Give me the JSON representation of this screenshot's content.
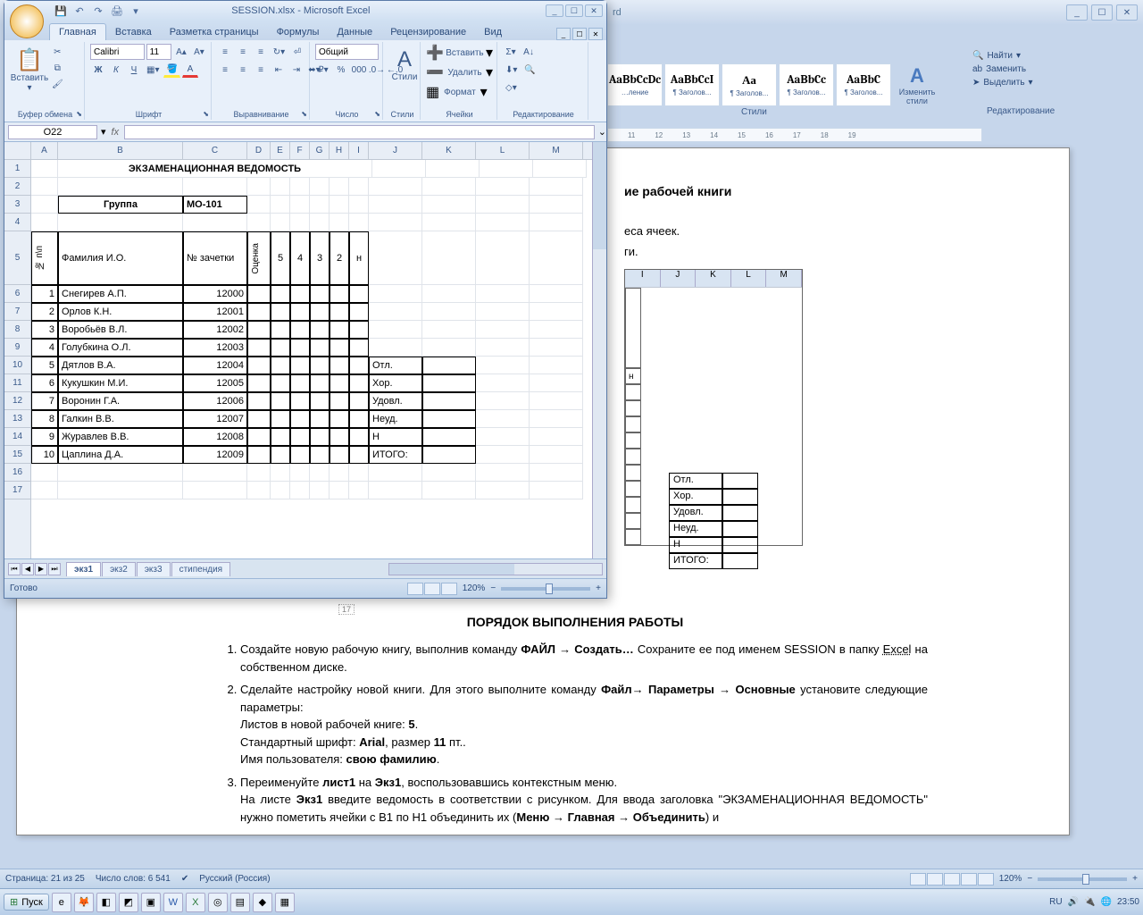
{
  "excel": {
    "title": "SESSION.xlsx - Microsoft Excel",
    "tabs": [
      "Главная",
      "Вставка",
      "Разметка страницы",
      "Формулы",
      "Данные",
      "Рецензирование",
      "Вид"
    ],
    "active_tab": 0,
    "groups": {
      "clipboard": "Буфер обмена",
      "font": "Шрифт",
      "alignment": "Выравнивание",
      "number": "Число",
      "styles": "Стили",
      "cells": "Ячейки",
      "editing": "Редактирование"
    },
    "paste": "Вставить",
    "font_name": "Calibri",
    "font_size": "11",
    "number_format": "Общий",
    "cells_insert": "Вставить",
    "cells_delete": "Удалить",
    "cells_format": "Формат",
    "styles_btn": "Стили",
    "name_box": "O22",
    "fx": "fx",
    "sheet_tabs": [
      "экз1",
      "экз2",
      "экз3",
      "стипендия"
    ],
    "active_sheet": 0,
    "status": "Готово",
    "zoom": "120%",
    "columns": [
      "A",
      "B",
      "C",
      "D",
      "E",
      "F",
      "G",
      "H",
      "I",
      "J",
      "K",
      "L",
      "M"
    ],
    "title_cell": "ЭКЗАМЕНАЦИОННАЯ ВЕДОМОСТЬ",
    "group_label": "Группа",
    "group_value": "МО-101",
    "headers": {
      "num": "№ п\\п",
      "fio": "Фамилия И.О.",
      "zach": "№ зачетки",
      "grade": "Оценка",
      "g5": "5",
      "g4": "4",
      "g3": "3",
      "g2": "2",
      "gn": "н"
    },
    "rows": [
      {
        "n": "1",
        "fio": "Снегирев А.П.",
        "z": "12000"
      },
      {
        "n": "2",
        "fio": "Орлов К.Н.",
        "z": "12001"
      },
      {
        "n": "3",
        "fio": "Воробьёв В.Л.",
        "z": "12002"
      },
      {
        "n": "4",
        "fio": "Голубкина О.Л.",
        "z": "12003"
      },
      {
        "n": "5",
        "fio": "Дятлов В.А.",
        "z": "12004"
      },
      {
        "n": "6",
        "fio": "Кукушкин М.И.",
        "z": "12005"
      },
      {
        "n": "7",
        "fio": "Воронин Г.А.",
        "z": "12006"
      },
      {
        "n": "8",
        "fio": "Галкин В.В.",
        "z": "12007"
      },
      {
        "n": "9",
        "fio": "Журавлев В.В.",
        "z": "12008"
      },
      {
        "n": "10",
        "fio": "Цаплина Д.А.",
        "z": "12009"
      }
    ],
    "summary": [
      "Отл.",
      "Хор.",
      "Удовл.",
      "Неуд.",
      "Н",
      "ИТОГО:"
    ]
  },
  "word": {
    "title_suffix": "rd",
    "style_samples": [
      "AaBbCcDc",
      "AaBbCcI",
      "Aа",
      "AaBbCc",
      "AaBbC"
    ],
    "style_names": [
      "…ление",
      "¶ Заголов...",
      "¶ Заголов...",
      "¶ Заголов...",
      "¶ Заголов..."
    ],
    "change_styles": "Изменить стили",
    "styles_label": "Стили",
    "editing": {
      "find": "Найти",
      "replace": "Заменить",
      "select": "Выделить",
      "label": "Редактирование"
    },
    "ruler_marks": [
      "11",
      "12",
      "13",
      "14",
      "15",
      "16",
      "17",
      "18",
      "19"
    ],
    "frag_title": "ие рабочей книги",
    "frag_line2": "еса ячеек.",
    "frag_line3": "ги.",
    "inner_cols": [
      "I",
      "J",
      "K",
      "L",
      "M"
    ],
    "inner_n": "н",
    "inner_summary": [
      "Отл.",
      "Хор.",
      "Удовл.",
      "Неуд.",
      "Н",
      "ИТОГО:"
    ],
    "page_marker": "17",
    "content": {
      "heading": "ПОРЯДОК ВЫПОЛНЕНИЯ РАБОТЫ",
      "li1_p1": "Создайте новую рабочую книгу, выполнив команду ",
      "li1_b1": "ФАЙЛ",
      "li1_b2": "Создать…",
      "li1_p2": " Сохраните ее под именем SESSION в папку ",
      "li1_u1": "Excel",
      "li1_p3": " на собственном диске.",
      "li2_p1": "Сделайте настройку новой книги. Для этого выполните команду  ",
      "li2_b1": "Файл",
      "li2_b2": "Параметры",
      "li2_b3": "Основные",
      "li2_p2": "  установите следующие параметры:",
      "li2_line3": "Листов  в новой рабочей книге: ",
      "li2_v3": "5",
      "li2_line4a": "Стандартный шрифт: ",
      "li2_v4a": "Arial",
      "li2_line4b": ", размер ",
      "li2_v4b": "11",
      "li2_line4c": " пт..",
      "li2_line5": "Имя пользователя: ",
      "li2_v5": "свою фамилию",
      "li3_p1": "Переименуйте ",
      "li3_b1": "лист1",
      "li3_p2": " на ",
      "li3_b2": "Экз1",
      "li3_p3": ", воспользовавшись контекстным меню.",
      "li3_line2a": "На листе ",
      "li3_line2b": "Экз1",
      "li3_line2c": " введите ведомость в соответствии с рисунком. Для ввода заголовка \"ЭКЗАМЕНАЦИОННАЯ ВЕДОМОСТЬ\" нужно пометить ячейки с B1 по H1 объединить их (",
      "li3_b3": "Меню",
      "li3_b4": "Главная",
      "li3_b5": "Объединить",
      "li3_tail": ") и"
    },
    "status": {
      "page": "Страница: 21 из 25",
      "words": "Число слов: 6 541",
      "lang": "Русский (Россия)",
      "zoom": "120%"
    }
  },
  "taskbar": {
    "start": "Пуск",
    "lang": "RU",
    "time": "23:50"
  }
}
